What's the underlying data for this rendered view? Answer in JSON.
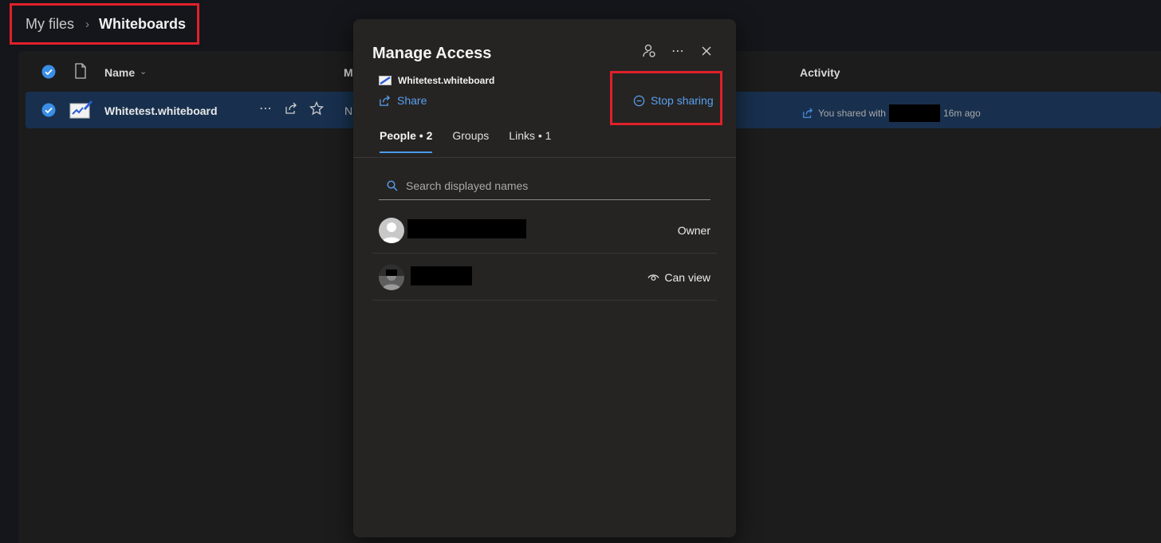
{
  "breadcrumb": {
    "root": "My files",
    "separator": "›",
    "current": "Whiteboards"
  },
  "list": {
    "columns": {
      "name": "Name",
      "modified": "M",
      "activity": "Activity"
    },
    "rows": [
      {
        "name": "Whitetest.whiteboard",
        "modified": "N",
        "activity_prefix": "You shared with",
        "activity_suffix": "16m ago"
      }
    ]
  },
  "dialog": {
    "title": "Manage Access",
    "file_name": "Whitetest.whiteboard",
    "share_label": "Share",
    "stop_sharing_label": "Stop sharing",
    "tabs": [
      {
        "label": "People • 2",
        "active": true
      },
      {
        "label": "Groups",
        "active": false
      },
      {
        "label": "Links • 1",
        "active": false
      }
    ],
    "search_placeholder": "Search displayed names",
    "people": [
      {
        "role": "Owner"
      },
      {
        "role": "Can view"
      }
    ]
  },
  "colors": {
    "accent": "#4a9be8",
    "link": "#5aa0ef",
    "highlight_box": "#e0202a",
    "selected_row": "#18304e"
  }
}
